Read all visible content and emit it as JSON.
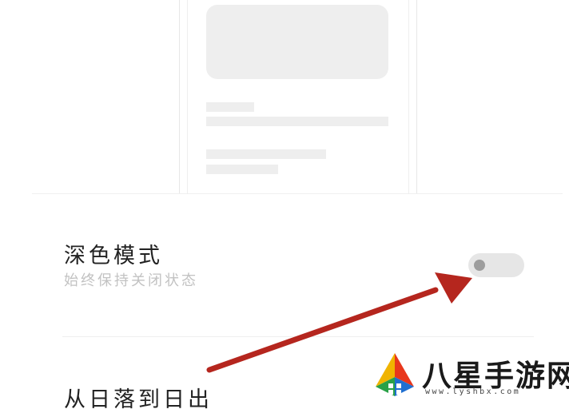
{
  "settings": {
    "dark_mode": {
      "title": "深色模式",
      "subtitle": "始终保持关闭状态",
      "enabled": false
    },
    "next_option": {
      "title": "从日落到日出"
    }
  },
  "watermark": {
    "name": "八星手游网",
    "url": "www.lyshbx.com"
  },
  "colors": {
    "arrow": "#b5261e",
    "toggle_track": "#e6e6e6",
    "toggle_knob": "#9d9d9d",
    "placeholder": "#eeeeee"
  }
}
